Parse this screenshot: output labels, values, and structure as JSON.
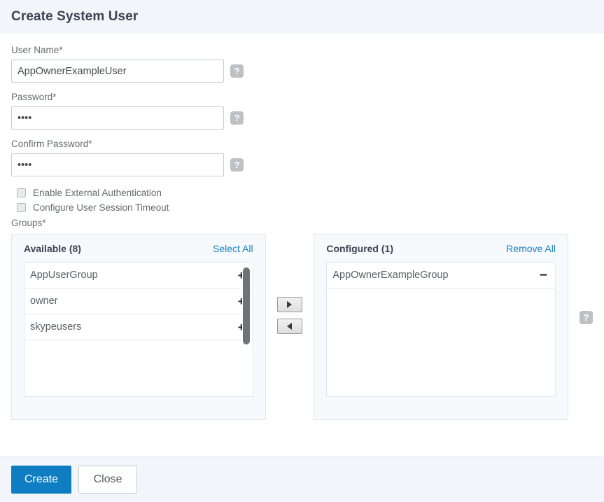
{
  "dialog": {
    "title": "Create System User"
  },
  "form": {
    "username": {
      "label": "User Name*",
      "value": "AppOwnerExampleUser",
      "placeholder": "",
      "help": "?"
    },
    "password": {
      "label": "Password*",
      "value": "••••",
      "placeholder": "",
      "help": "?"
    },
    "confirm_password": {
      "label": "Confirm Password*",
      "value": "••••",
      "placeholder": "",
      "help": "?"
    },
    "checkboxes": [
      {
        "label": "Enable External Authentication",
        "checked": false
      },
      {
        "label": "Configure User Session Timeout",
        "checked": false
      }
    ],
    "groups_label": "Groups*",
    "groups_help": "?"
  },
  "transfer": {
    "available": {
      "title": "Available (8)",
      "action_label": "Select All",
      "items": [
        {
          "label": "AppUserGroup",
          "button": "+"
        },
        {
          "label": "owner",
          "button": "+"
        },
        {
          "label": "skypeusers",
          "button": "+"
        }
      ]
    },
    "configured": {
      "title": "Configured (1)",
      "action_label": "Remove All",
      "items": [
        {
          "label": "AppOwnerExampleGroup",
          "button": "−"
        }
      ]
    }
  },
  "footer": {
    "create_label": "Create",
    "close_label": "Close"
  },
  "colors": {
    "accent": "#0f7dc2",
    "link": "#1c7fc3",
    "header_bg": "#f2f6fa",
    "panel_bg": "#f7fafc",
    "title_text": "#3d4353",
    "label_text": "#666b71"
  }
}
